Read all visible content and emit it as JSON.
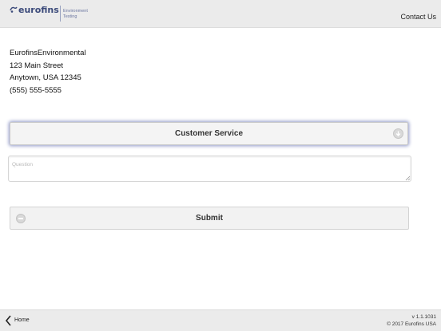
{
  "header": {
    "logo_word": "eurofins",
    "logo_sub_line1": "Environment",
    "logo_sub_line2": "Testing",
    "contact_label": "Contact Us"
  },
  "address": {
    "name": "EurofinsEnvironmental",
    "street": "123 Main Street",
    "city": "Anytown, USA 12345",
    "phone": "(555) 555-5555"
  },
  "form": {
    "topic_selected": "Customer Service",
    "question_placeholder": "Question",
    "question_value": "",
    "submit_label": "Submit"
  },
  "footer": {
    "home_label": "Home",
    "version": "v 1.1.1031",
    "copyright": "© 2017 Eurofins USA"
  },
  "colors": {
    "bar_background": "#ebebeb",
    "brand": "#3b4a7a",
    "focus_glow": "#8f98c8"
  }
}
